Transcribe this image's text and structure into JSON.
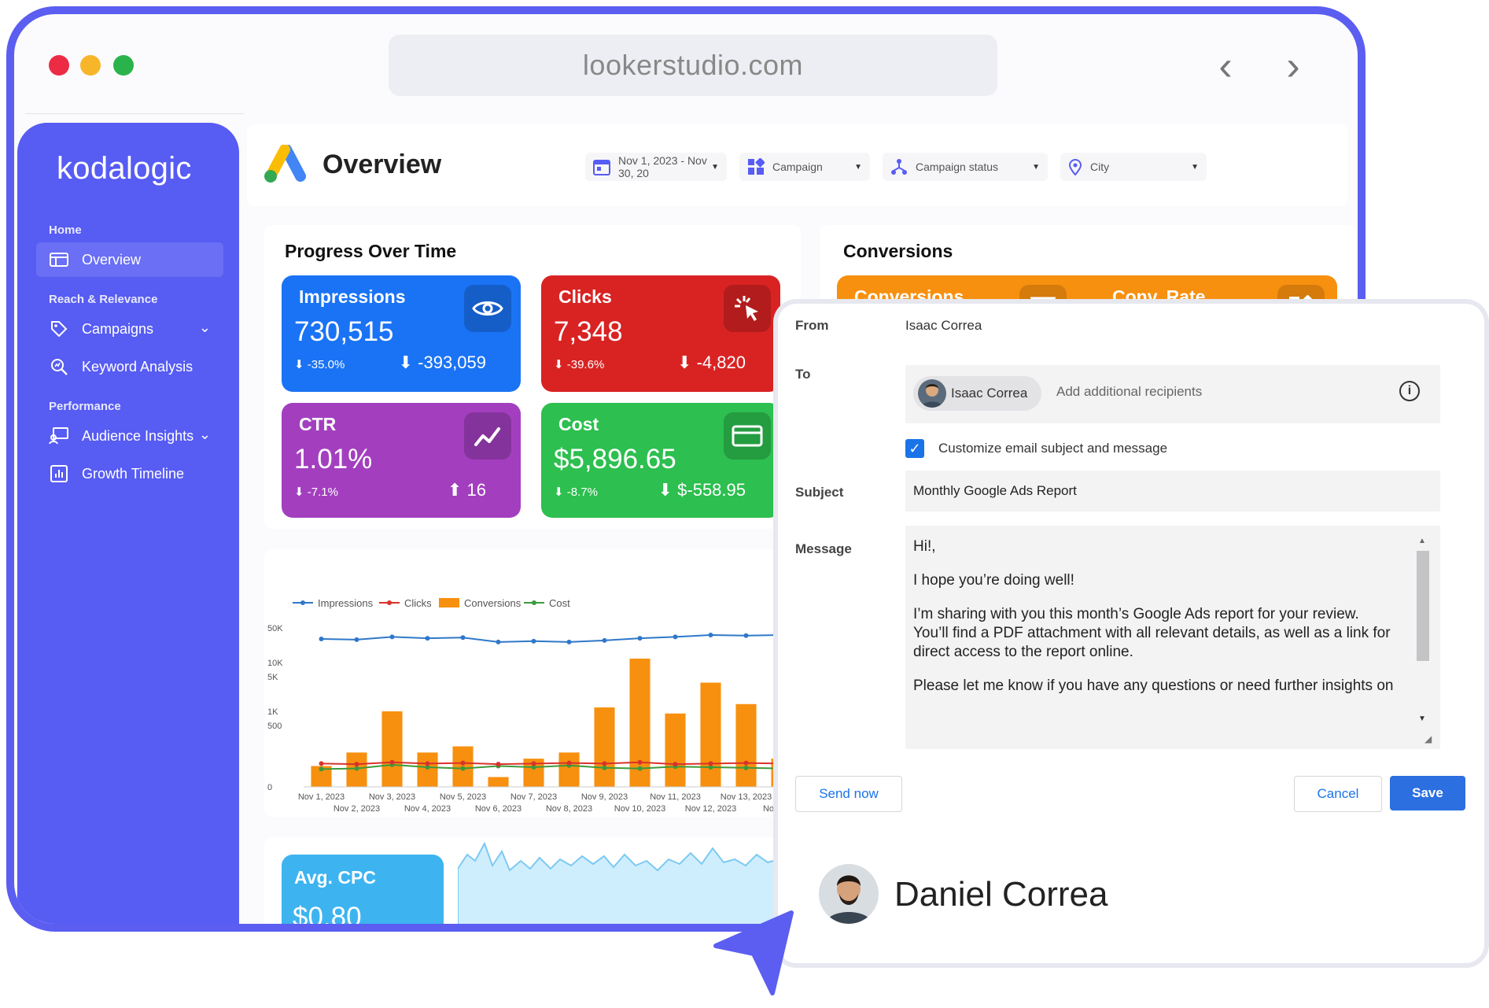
{
  "browser": {
    "url": "lookerstudio.com",
    "back_label": "‹",
    "forward_label": "›"
  },
  "window_dots": {
    "colors": [
      "#ec2b45",
      "#f7b62a",
      "#2ab34a"
    ]
  },
  "sidebar": {
    "brand": "kodalogic",
    "sections": {
      "home": "Home",
      "reach": "Reach & Relevance",
      "performance": "Performance"
    },
    "items": [
      {
        "label": "Overview",
        "icon": "dashboard-icon",
        "active": true
      },
      {
        "label": "Campaigns",
        "icon": "tag-icon",
        "expandable": true
      },
      {
        "label": "Keyword Analysis",
        "icon": "search-analytics-icon"
      },
      {
        "label": "Audience Insights",
        "icon": "audience-icon",
        "expandable": true
      },
      {
        "label": "Growth Timeline",
        "icon": "bar-chart-icon"
      }
    ]
  },
  "header": {
    "title": "Overview",
    "logo_icon": "google-ads-icon",
    "filters": {
      "date": "Nov 1, 2023 - Nov 30, 20",
      "campaign": "Campaign",
      "status": "Campaign status",
      "city": "City"
    }
  },
  "progress": {
    "title": "Progress Over Time",
    "kpis": [
      {
        "title": "Impressions",
        "value": "730,515",
        "pct": "-35.0%",
        "delta": "-393,059",
        "color": "#1a73f5",
        "icon": "eye-icon"
      },
      {
        "title": "Clicks",
        "value": "7,348",
        "pct": "-39.6%",
        "delta": "-4,820",
        "color": "#d92323",
        "icon": "click-icon"
      },
      {
        "title": "CTR",
        "value": "1.01%",
        "pct": "-7.1%",
        "delta": "16",
        "color": "#a33fbf",
        "icon": "trend-icon"
      },
      {
        "title": "Cost",
        "value": "$5,896.65",
        "pct": "-8.7%",
        "delta": "$-558.95",
        "color": "#2dbf4f",
        "icon": "card-icon"
      }
    ]
  },
  "conversions": {
    "title": "Conversions",
    "tiles": [
      {
        "title": "Conversions",
        "icon": "funnel-icon"
      },
      {
        "title": "Conv. Rate",
        "icon": "shapes-icon"
      }
    ]
  },
  "chart_data": {
    "type": "bar",
    "legend": [
      "Impressions",
      "Clicks",
      "Conversions",
      "Cost"
    ],
    "series_colors": {
      "Impressions": "#2f78c9",
      "Clicks": "#d9322b",
      "Conversions": "#f7900f",
      "Cost": "#3c9a3c"
    },
    "y_ticks": [
      "50K",
      "10K",
      "5K",
      "1K",
      "500",
      "0"
    ],
    "x_top": [
      "Nov 1, 2023",
      "Nov 3, 2023",
      "Nov 5, 2023",
      "Nov 7, 2023",
      "Nov 9, 2023",
      "Nov 11, 2023",
      "Nov 13, 2023"
    ],
    "x_bottom": [
      "Nov 2, 2023",
      "Nov 4, 2023",
      "Nov 6, 2023",
      "Nov 8, 2023",
      "Nov 10, 2023",
      "Nov 12, 2023",
      "Nov 14, 2"
    ],
    "conversions": [
      170,
      280,
      1000,
      280,
      330,
      80,
      230,
      280,
      1200,
      12000,
      900,
      3800,
      1400,
      230
    ],
    "impressions": [
      30000,
      29000,
      33000,
      31000,
      32000,
      26000,
      27000,
      26000,
      28000,
      31000,
      33000,
      36000,
      35000,
      36000
    ],
    "clicks": [
      190,
      185,
      200,
      190,
      195,
      185,
      190,
      195,
      190,
      200,
      185,
      190,
      195,
      190
    ],
    "cost": [
      145,
      150,
      180,
      160,
      150,
      170,
      160,
      175,
      155,
      150,
      165,
      160,
      155,
      150
    ]
  },
  "avg_cpc": {
    "title": "Avg. CPC",
    "value": "$0.80"
  },
  "email": {
    "from_label": "From",
    "from_value": "Isaac Correa",
    "to_label": "To",
    "recipient_chip": "Isaac Correa",
    "recipients_placeholder": "Add additional recipients",
    "customize_label": "Customize email subject and message",
    "customize_checked": true,
    "subject_label": "Subject",
    "subject_value": "Monthly Google Ads Report",
    "message_label": "Message",
    "message_lines": [
      "Hi!,",
      "",
      "I hope you’re doing well!",
      "",
      "I’m sharing with you this month’s Google Ads report for your review.",
      "You’ll find a PDF attachment with all relevant details, as well as a link for",
      "direct access to the report online.",
      "",
      "Please let me know if you have any questions or need further insights on"
    ],
    "send_now": "Send now",
    "cancel": "Cancel",
    "save": "Save"
  },
  "user": {
    "name": "Daniel Correa"
  },
  "accent": "#575cf3"
}
